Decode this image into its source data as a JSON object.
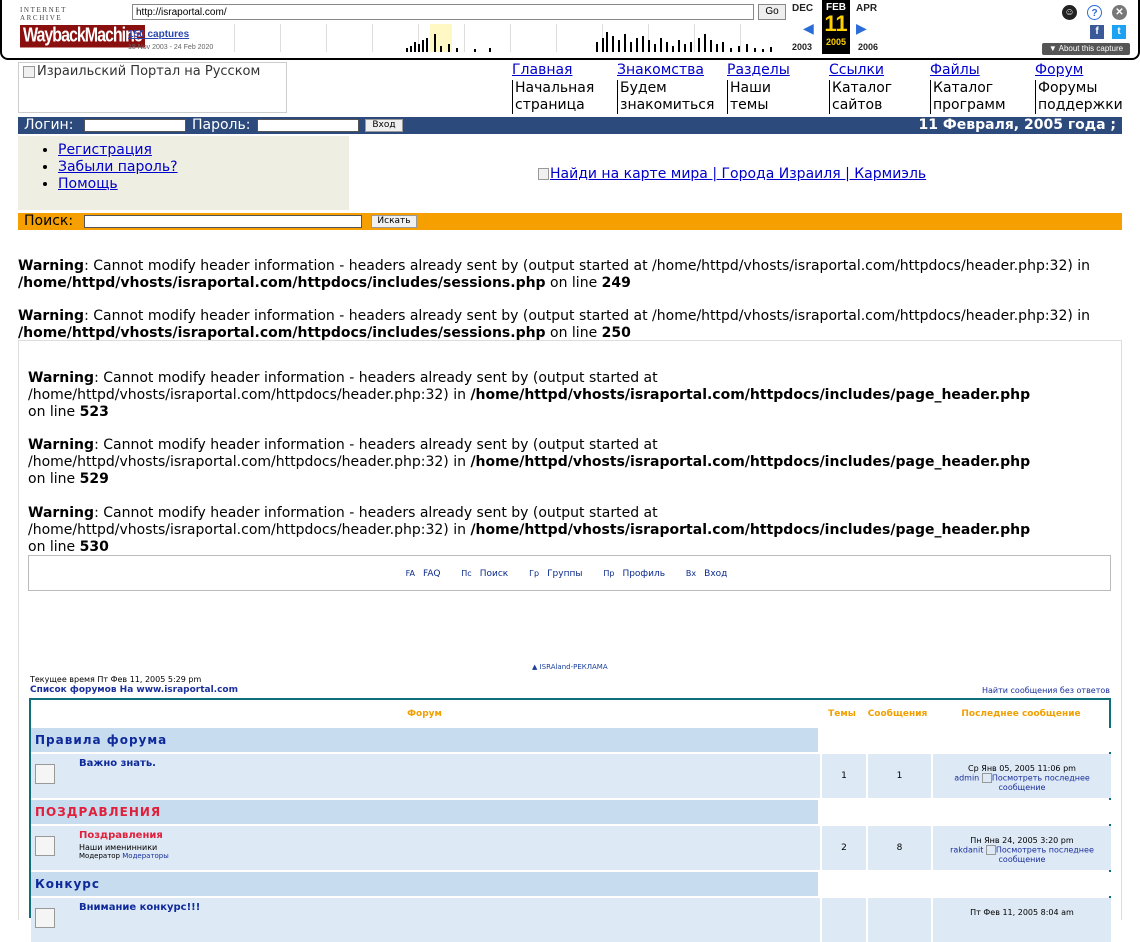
{
  "wayback": {
    "ia_text": "INTERNET ARCHIVE",
    "logo_text": "WaybackMachine",
    "url": "http://israportal.com/",
    "go_label": "Go",
    "captures": "150 captures",
    "range": "18 Nov 2003 - 24 Feb 2020",
    "prev_month": "DEC",
    "cur_month": "FEB",
    "next_month": "APR",
    "day": "11",
    "prev_year": "2003",
    "cur_year": "2005",
    "next_year": "2006",
    "about": "▼ About this capture"
  },
  "portal": {
    "logo_alt": "Израильский Портал на Русском",
    "nav": [
      {
        "label": "Главная",
        "line1": "Начальная",
        "line2": "страница"
      },
      {
        "label": "Знакомства",
        "line1": "Будем",
        "line2": "знакомиться"
      },
      {
        "label": "Разделы",
        "line1": "Наши",
        "line2": "темы"
      },
      {
        "label": "Ссылки",
        "line1": "Каталог",
        "line2": "сайтов"
      },
      {
        "label": "Файлы",
        "line1": "Каталог",
        "line2": "программ"
      },
      {
        "label": "Форум",
        "line1": "Форумы",
        "line2": "поддержки"
      }
    ],
    "login_label": "Логин:",
    "password_label": "Пароль:",
    "login_button": "Вход",
    "date": "11 Февраля, 2005 года ;",
    "menu": [
      "Регистрация",
      "Забыли пароль?",
      "Помощь"
    ],
    "banner": "Найди на карте мира | Города Израиля | Кармиэль",
    "search_label": "Поиск:",
    "search_button": "Искать"
  },
  "warnings": [
    {
      "label": "Warning",
      "msg": ": Cannot modify header information - headers already sent by (output started at /home/httpd/vhosts/israportal.com/httpdocs/header.php:32)",
      "in": "in",
      "file": "/home/httpd/vhosts/israportal.com/httpdocs/includes/sessions.php",
      "online": "on line",
      "line": "249"
    },
    {
      "label": "Warning",
      "msg": ": Cannot modify header information - headers already sent by (output started at /home/httpd/vhosts/israportal.com/httpdocs/header.php:32)",
      "in": "in",
      "file": "/home/httpd/vhosts/israportal.com/httpdocs/includes/sessions.php",
      "online": "on line",
      "line": "250"
    },
    {
      "label": "Warning",
      "msg": ": Cannot modify header information - headers already sent by (output started at",
      "path": "/home/httpd/vhosts/israportal.com/httpdocs/header.php:32) in",
      "file": "/home/httpd/vhosts/israportal.com/httpdocs/includes/page_header.php",
      "online": "on line",
      "line": "523"
    },
    {
      "label": "Warning",
      "msg": ": Cannot modify header information - headers already sent by (output started at",
      "path": "/home/httpd/vhosts/israportal.com/httpdocs/header.php:32) in",
      "file": "/home/httpd/vhosts/israportal.com/httpdocs/includes/page_header.php",
      "online": "on line",
      "line": "529"
    },
    {
      "label": "Warning",
      "msg": ": Cannot modify header information - headers already sent by (output started at",
      "path": "/home/httpd/vhosts/israportal.com/httpdocs/header.php:32) in",
      "file": "/home/httpd/vhosts/israportal.com/httpdocs/includes/page_header.php",
      "online": "on line",
      "line": "530"
    }
  ],
  "forum": {
    "links": [
      {
        "alt": "FA",
        "label": "FAQ"
      },
      {
        "alt": "Пс",
        "label": "Поиск"
      },
      {
        "alt": "Гр",
        "label": "Группы"
      },
      {
        "alt": "Пр",
        "label": "Профиль"
      },
      {
        "alt": "Вх",
        "label": "Вход"
      }
    ],
    "ad": "ISRAland-РЕКЛАМА",
    "current_time": "Текущее время Пт Фев 11, 2005 5:29 pm",
    "index_link": "Список форумов На www.israportal.com",
    "no_answer_link": "Найти сообщения без ответов",
    "col_forum": "Форум",
    "col_topics": "Темы",
    "col_posts": "Сообщения",
    "col_last": "Последнее сообщение",
    "categories": [
      {
        "name": "Правила форума",
        "color": "#0e2a9a"
      },
      {
        "name": "ПОЗДРАВЛЕНИЯ",
        "color": "#e0203a"
      },
      {
        "name": "Конкурс",
        "color": "#0e2a9a"
      }
    ],
    "rows": [
      {
        "title": "Важно знать.",
        "title_color": "#0e2a9a",
        "desc": "",
        "moderator_label": "",
        "moderator": "",
        "topics": "1",
        "posts": "1",
        "last_date": "Ср Янв 05, 2005 11:06 pm",
        "last_user": "admin",
        "last_link": "Посмотреть последнее сообщение"
      },
      {
        "title": "Поздравления",
        "title_color": "#e0203a",
        "desc": "Наши именинники",
        "moderator_label": "Модератор",
        "moderator": "Модераторы",
        "topics": "2",
        "posts": "8",
        "last_date": "Пн Янв 24, 2005 3:20 pm",
        "last_user": "rakdanit",
        "last_link": "Посмотреть последнее сообщение"
      },
      {
        "title": "Внимание конкурс!!!",
        "title_color": "#0e2a9a",
        "desc": "",
        "moderator_label": "",
        "moderator": "",
        "topics": "",
        "posts": "",
        "last_date": "Пт Фев 11, 2005 8:04 am",
        "last_user": "",
        "last_link": ""
      }
    ]
  }
}
